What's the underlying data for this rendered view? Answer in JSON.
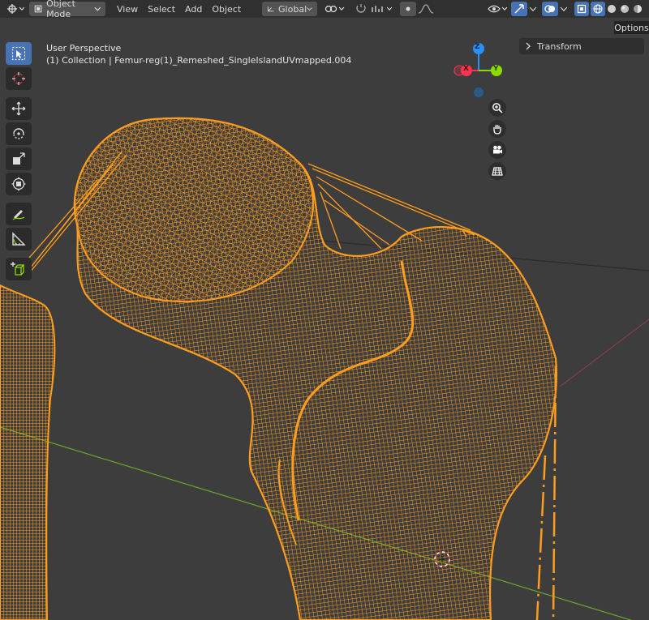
{
  "header": {
    "mode_label": "Object Mode",
    "menu": [
      "View",
      "Select",
      "Add",
      "Object"
    ],
    "transform_orientation": "Global"
  },
  "viewport": {
    "perspective_label": "User Perspective",
    "object_label": "(1) Collection | Femur-reg(1)_Remeshed_SingleIslandUVmapped.004",
    "gizmo": {
      "z": "Z",
      "x": "X",
      "y": "Y"
    },
    "options_label": "Options",
    "transform_label": "Transform"
  },
  "colors": {
    "mesh_wire": "#ff9d1e",
    "axis_x": "#ff3352",
    "axis_y": "#8bdc00",
    "axis_z": "#2890ff",
    "active_tool": "#4772b3"
  },
  "icons": {
    "toolbar": [
      "select-box-icon",
      "cursor-icon",
      "move-icon",
      "rotate-icon",
      "scale-icon",
      "transform-icon",
      "annotate-icon",
      "measure-icon",
      "add-cube-icon"
    ],
    "nav": [
      "zoom-icon",
      "hand-pan-icon",
      "camera-icon",
      "grid-ortho-icon"
    ]
  }
}
